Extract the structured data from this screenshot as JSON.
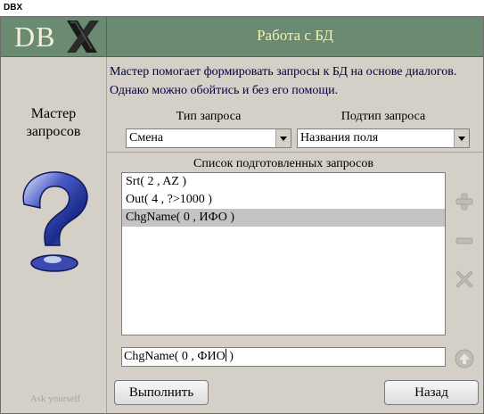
{
  "window": {
    "title": "DBX"
  },
  "logo": {
    "text": "DB"
  },
  "header": {
    "title": "Работа с БД"
  },
  "left": {
    "title_line1": "Мастер",
    "title_line2": "запросов",
    "footer": "Ask yourself"
  },
  "description": "Мастер помогает формировать запросы к БД на основе диалогов. Однако можно обойтись и без его помощи.",
  "query_type": {
    "label": "Тип запроса",
    "value": "Смена"
  },
  "query_subtype": {
    "label": "Подтип запроса",
    "value": "Названия поля"
  },
  "list": {
    "label": "Список подготовленных запросов",
    "items": [
      "Srt( 2 , AZ )",
      "Out( 4 , ?>1000 )",
      "ChgName( 0 , ИФО )"
    ],
    "selected_index": 2
  },
  "side_buttons": [
    "plus-icon",
    "minus-icon",
    "close-icon",
    "arrow-up-icon"
  ],
  "edit": {
    "value_before_caret": "ChgName( 0 , ФИО",
    "value_after_caret": " )"
  },
  "buttons": {
    "execute": "Выполнить",
    "back": "Назад"
  },
  "colors": {
    "header_bg": "#6a8a72",
    "header_text": "#f4f0b0",
    "selection": "#c6c3c6"
  }
}
